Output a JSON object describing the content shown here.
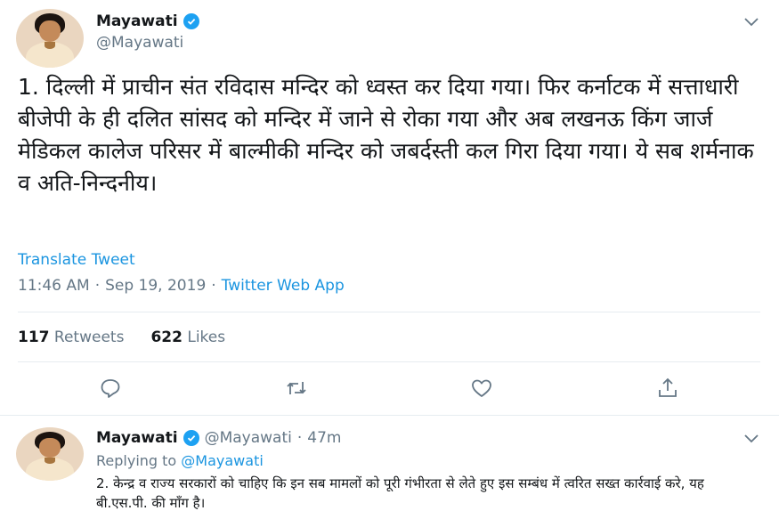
{
  "main_tweet": {
    "author_name": "Mayawati",
    "author_handle": "@Mayawati",
    "text": "1. दिल्ली में प्राचीन संत रविदास मन्दिर को ध्वस्त कर दिया गया। फिर कर्नाटक में सत्ताधारी बीजेपी के ही दलित सांसद को मन्दिर में जाने से रोका गया और अब लखनऊ किंग जार्ज मेडिकल कालेज परिसर में बाल्मीकी मन्दिर को जबर्दस्ती कल गिरा दिया गया। ये सब शर्मनाक व अति-निन्दनीय।",
    "translate_label": "Translate Tweet",
    "time": "11:46 AM",
    "date": "Sep 19, 2019",
    "source": "Twitter Web App",
    "retweets_count": "117",
    "retweets_label": "Retweets",
    "likes_count": "622",
    "likes_label": "Likes"
  },
  "actions": {
    "icons": [
      "reply-icon",
      "retweet-icon",
      "like-icon",
      "share-icon"
    ]
  },
  "reply_tweet": {
    "author_name": "Mayawati",
    "author_handle": "@Mayawati",
    "age": "47m",
    "replying_prefix": "Replying to",
    "replying_to": "@Mayawati",
    "text": "2. केन्द्र व राज्य सरकारों को चाहिए कि इन सब मामलों को पूरी गंभीरता से लेते हुए इस सम्बंध में त्वरित सख्त कार्रवाई करे, यह बी.एस.पी. की माँग है।"
  },
  "colors": {
    "accent": "#1b95e0",
    "muted": "#657786",
    "verified": "#1da1f2",
    "divider": "#e6ecf0"
  }
}
